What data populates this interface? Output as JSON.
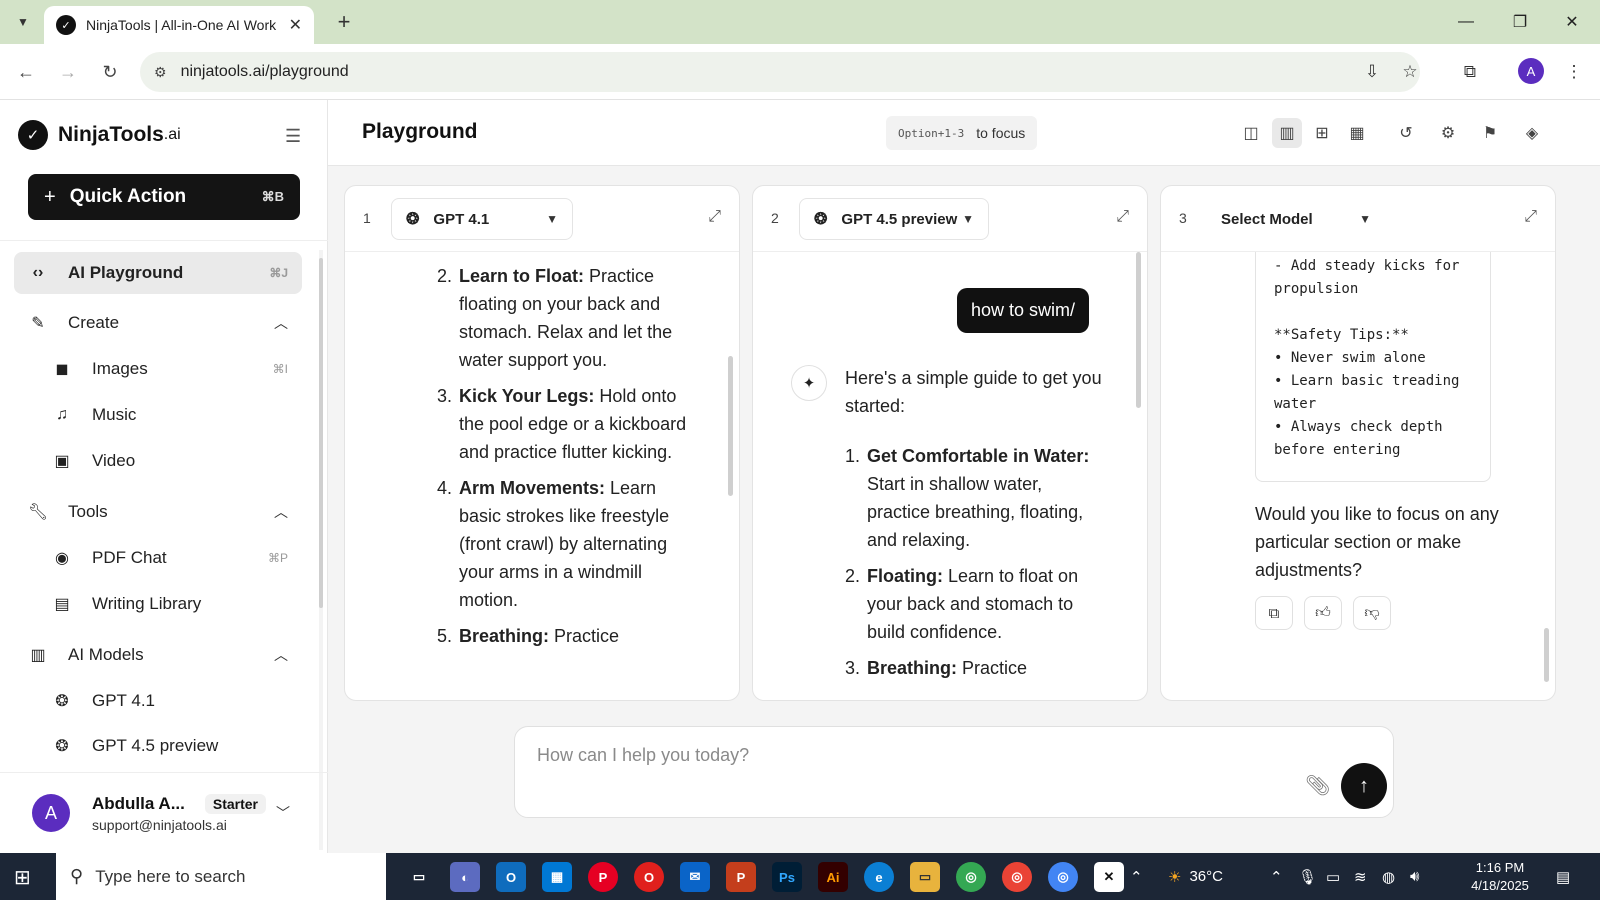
{
  "browser": {
    "tab_title": "NinjaTools | All-in-One AI Work",
    "url": "ninjatools.ai/playground",
    "profile_initial": "A"
  },
  "sidebar": {
    "brand": "NinjaTools",
    "brand_suffix": ".ai",
    "quick_action": {
      "label": "Quick Action",
      "shortcut": "⌘B"
    },
    "items": [
      {
        "label": "AI Playground",
        "shortcut": "⌘J"
      },
      {
        "label": "Create"
      },
      {
        "label": "Images",
        "shortcut": "⌘I"
      },
      {
        "label": "Music"
      },
      {
        "label": "Video"
      },
      {
        "label": "Tools"
      },
      {
        "label": "PDF Chat",
        "shortcut": "⌘P"
      },
      {
        "label": "Writing Library"
      },
      {
        "label": "AI Models"
      },
      {
        "label": "GPT 4.1"
      },
      {
        "label": "GPT 4.5 preview"
      }
    ],
    "user": {
      "name": "Abdulla A...",
      "plan": "Starter",
      "email": "support@ninjatools.ai",
      "initial": "A"
    }
  },
  "header": {
    "title": "Playground",
    "focus_keys": "Option+1-3",
    "focus_text": "to focus"
  },
  "panels": [
    {
      "number": "1",
      "model": "GPT 4.1",
      "steps": [
        {
          "n": "2.",
          "title": "Learn to Float:",
          "text": " Practice floating on your back and stomach. Relax and let the water support you."
        },
        {
          "n": "3.",
          "title": "Kick Your Legs:",
          "text": " Hold onto the pool edge or a kickboard and practice flutter kicking."
        },
        {
          "n": "4.",
          "title": "Arm Movements:",
          "text": " Learn basic strokes like freestyle (front crawl) by alternating your arms in a windmill motion."
        },
        {
          "n": "5.",
          "title": "Breathing:",
          "text": " Practice"
        }
      ]
    },
    {
      "number": "2",
      "model": "GPT 4.5 preview",
      "user_message": "how to swim/",
      "intro": "Here's a simple guide to get you started:",
      "steps": [
        {
          "n": "1.",
          "title": "Get Comfortable in Water:",
          "text": " Start in shallow water, practice breathing, floating, and relaxing."
        },
        {
          "n": "2.",
          "title": "Floating:",
          "text": " Learn to float on your back and stomach to build confidence."
        },
        {
          "n": "3.",
          "title": "Breathing:",
          "text": " Practice"
        }
      ]
    },
    {
      "number": "3",
      "model": "Select Model",
      "code": "- Add steady kicks for\npropulsion\n\n**Safety Tips:**\n• Never swim alone\n• Learn basic treading\nwater\n• Always check depth\nbefore entering",
      "followup": "Would you like to focus on any particular section or make adjustments?"
    }
  ],
  "composer": {
    "placeholder": "How can I help you today?"
  },
  "taskbar": {
    "search_placeholder": "Type here to search",
    "temperature": "36°C",
    "time": "1:16 PM",
    "date": "4/18/2025"
  }
}
